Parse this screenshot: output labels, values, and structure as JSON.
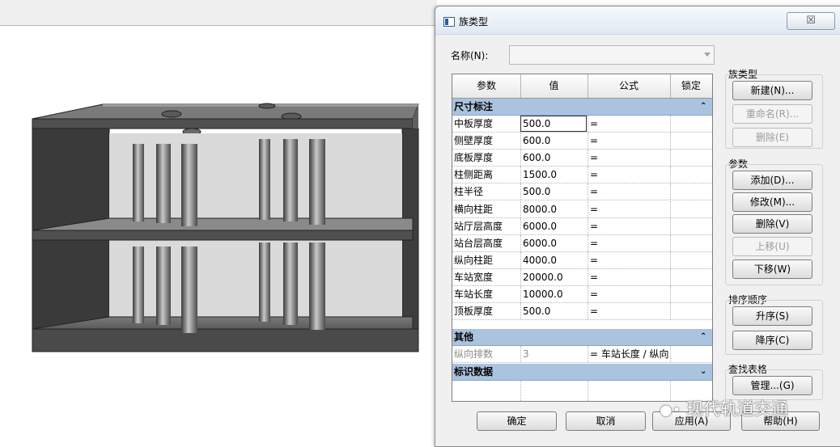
{
  "dialog": {
    "title": "族类型",
    "close_glyph": "☒",
    "name_label": "名称(N):",
    "name_value": ""
  },
  "table": {
    "headers": [
      "参数",
      "值",
      "公式",
      "锁定"
    ],
    "groups": {
      "dimensions": "尺寸标注",
      "other": "其他",
      "identity": "标识数据"
    },
    "rows": [
      {
        "param": "中板厚度",
        "value": "500.0",
        "formula": "=",
        "locked": false
      },
      {
        "param": "侧壁厚度",
        "value": "600.0",
        "formula": "=",
        "locked": false
      },
      {
        "param": "底板厚度",
        "value": "600.0",
        "formula": "=",
        "locked": false
      },
      {
        "param": "柱侧距离",
        "value": "1500.0",
        "formula": "=",
        "locked": false
      },
      {
        "param": "柱半径",
        "value": "500.0",
        "formula": "=",
        "locked": false
      },
      {
        "param": "横向柱距",
        "value": "8000.0",
        "formula": "=",
        "locked": false
      },
      {
        "param": "站厅层高度",
        "value": "6000.0",
        "formula": "=",
        "locked": false
      },
      {
        "param": "站台层高度",
        "value": "6000.0",
        "formula": "=",
        "locked": false
      },
      {
        "param": "纵向柱距",
        "value": "4000.0",
        "formula": "=",
        "locked": true
      },
      {
        "param": "车站宽度",
        "value": "20000.0",
        "formula": "=",
        "locked": false
      },
      {
        "param": "车站长度",
        "value": "10000.0",
        "formula": "=",
        "locked": true
      },
      {
        "param": "顶板厚度",
        "value": "500.0",
        "formula": "=",
        "locked": false
      }
    ],
    "other_rows": [
      {
        "param": "纵向排数",
        "value": "3",
        "formula": "= 车站长度 / 纵向",
        "locked": true
      }
    ]
  },
  "side": {
    "family_types_title": "族类型",
    "new": "新建(N)...",
    "rename": "重命名(R)...",
    "delete_type": "删除(E)",
    "params_title": "参数",
    "add": "添加(D)...",
    "modify": "修改(M)...",
    "remove": "删除(V)",
    "move_up": "上移(U)",
    "move_down": "下移(W)",
    "sort_title": "排序顺序",
    "ascending": "升序(S)",
    "descending": "降序(C)",
    "lookup_title": "查找表格",
    "manage": "管理...(G)"
  },
  "footer": {
    "ok": "确定",
    "cancel": "取消",
    "apply": "应用(A)",
    "help": "帮助(H)"
  },
  "watermark": "现代轨道交通"
}
